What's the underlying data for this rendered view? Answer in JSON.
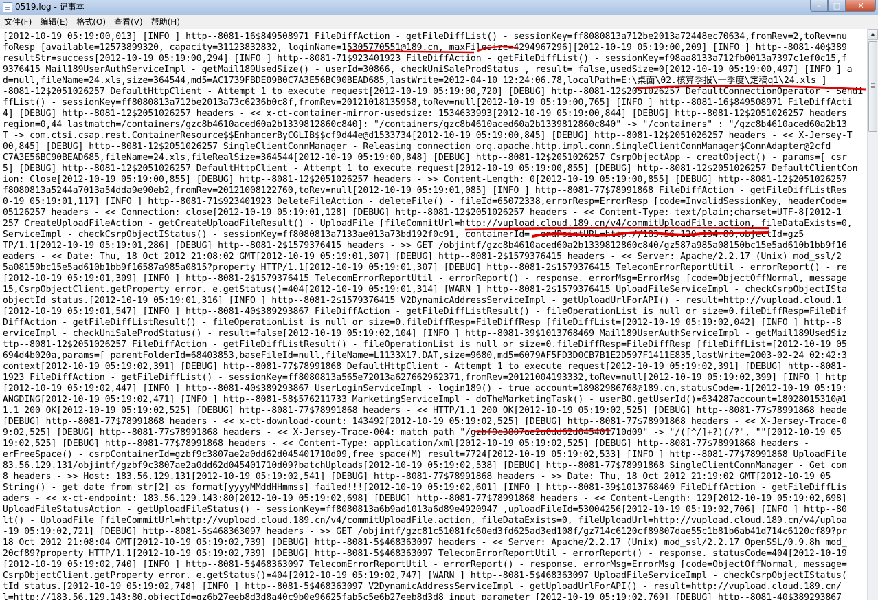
{
  "window": {
    "title": "0519.log - 记事本"
  },
  "menu": {
    "items": [
      "文件(F)",
      "编辑(E)",
      "格式(O)",
      "查看(V)",
      "帮助(H)"
    ]
  },
  "caption": {
    "min": "–",
    "max": "□",
    "close": "✕"
  },
  "scrollbar": {
    "up_arrow": "▲"
  },
  "document": {
    "lines": [
      "[2012-10-19 05:19:00,013] [INFO ] http--8081-16$849508971 FileDiffAction - getFileDiffList() - sessionKey=ff8080813a712be2013a72448ec70634,fromRev=2,toRev=nu",
      "foResp [available=12573899320, capacity=31123832832, loginName=15305770551@189.cn, maxFilesize=4294967296][2012-10-19 05:19:00,209] [INFO ] http--8081-40$389",
      "resultStr=success[2012-10-19 05:19:00,294] [INFO ] http--8081-71$923401923 FileDiffAction - getFileDiffList() - sessionKey=f98aa8133a712fb0013a7397c1ef0c15,f",
      "9376415 Mail189UserAuthServiceImpl - getMail189UsedSize() - userId=30866, checkUniSaleProdStatus , result= false,usedSize=0[2012-10-19 05:19:00,497] [INFO ] a",
      "d=null,fileName=24.xls,size=364544,md5=AC1739FBDE09B0C7A3E56BC90BEAD685,lastWrite=2012-04-10 12:24:06.78,localPath=E:\\桌面\\02.核算季报\\一季度\\定稿q1\\24.xls ]",
      "-8081-12$2051026257 DefaultHttpClient - Attempt 1 to execute request[2012-10-19 05:19:00,720] [DEBUG] http--8081-12$2051026257 DefaultConnectionOperator - Sendi",
      "ffList() - sessionKey=ff8080813a712be2013a73c6236b0c8f,fromRev=20121018135958,toRev=null[2012-10-19 05:19:00,765] [INFO ] http--8081-16$849508971 FileDiffActi",
      "4] [DEBUG] http--8081-12$2051026257 headers - << x-ct-container-mirror-usedsize: 1534633993[2012-10-19 05:19:00,844] [DEBUG] http--8081-12$2051026257 headers",
      "region=0,44 lastmatch=/containers/gzc8b4610aced60a2b1339812860c840]: \"/containers/gzc8b4610aced60a2b1339812860c840\" -> \"/containers\" : \"/gzc8b4610aced60a2b13",
      "T -> com.ctsi.csap.rest.ContainerResource$$EnhancerByCGLIB$$cf9d44e@d1533734[2012-10-19 05:19:00,845] [DEBUG] http--8081-12$2051026257 headers - << X-Jersey-T",
      "00,845] [DEBUG] http--8081-12$2051026257 SingleClientConnManager - Releasing connection org.apache.http.impl.conn.SingleClientConnManager$ConnAdapter@2cfd",
      "C7A3E56BC90BEAD685,fileName=24.xls,fileRealSize=364544[2012-10-19 05:19:00,848] [DEBUG] http--8081-12$2051026257 CsrpObjectApp - creatObject() - params=[ csr",
      "5] [DEBUG] http--8081-12$2051026257 DefaultHttpClient - Attempt 1 to execute request[2012-10-19 05:19:00,855] [DEBUG] http--8081-12$2051026257 DefaultClientCon",
      "ion: Close[2012-10-19 05:19:00,855] [DEBUG] http--8081-12$2051026257 headers - >> Content-Length: 0[2012-10-19 05:19:00,855] [DEBUG] http--8081-12$2051026257",
      "f8080813a5244a7013a54dda9e90eb2,fromRev=20121008122760,toRev=null[2012-10-19 05:19:01,085] [INFO ] http--8081-77$78991868 FileDiffAction - getFileDiffListRes",
      "0-19 05:19:01,117] [INFO ] http--8081-71$923401923 DeleteFileAction - deleteFile() - fileId=65072338,errorResp=ErrorResp [code=InvalidSessionKey, headerCode=",
      "05126257 headers - << Connection: close[2012-10-19 05:19:01,128] [DEBUG] http--8081-12$2051026257 headers - << Content-Type: text/plain;charset=UTF-8[2012-1",
      "257 CreateUploadFileAction - getCreateUploadFileResult() - UploadFile [fileCommitUrl=http://vupload.cloud.189.cn/v4/commitUploadFile.action, fileDataExists=0,",
      "ServiceImpl - checkCsrpObjectIStatus() - sessionKey=ff8080813a7133ae013a73bd192f0c91, containerId=, endPointURL=http://183.56.129.134:80,objectId=gz5",
      "TP/1.1[2012-10-19 05:19:01,286] [DEBUG] http--8081-2$1579376415 headers - >> GET /objintf/gzc8b4610aced60a2b1339812860c840/gz587a985a08150bc15e5ad610b1bb9f16",
      "eaders - << Date: Thu, 18 Oct 2012 21:08:02 GMT[2012-10-19 05:19:01,307] [DEBUG] http--8081-2$1579376415 headers - << Server: Apache/2.2.17 (Unix) mod_ssl/2",
      "5a08150bc15e5ad610b1bb9f16587a985a0815?property HTTP/1.1[2012-10-19 05:19:01,307] [DEBUG] http--8081-2$1579376415 TelecomErrorReportUtil - errorReport() - re",
      "[2012-10-19 05:19:01,309] [INFO ] http--8081-2$1579376415 TelecomErrorReportUtil - errorReport() - response. errorMsg=ErrorMsg [code=ObjectOffNormal, message",
      "15,CsrpObjectClient.getProperty error. e.getStatus()=404[2012-10-19 05:19:01,314] [WARN ] http--8081-2$1579376415 UploadFileServiceImpl - checkCsrpObjectISta",
      "objectId status.[2012-10-19 05:19:01,316] [INFO ] http--8081-2$1579376415 V2DynamicAddressServiceImpl - getUploadUrlForAPI() - result=http://vupload.cloud.1",
      "[2012-10-19 05:19:01,547] [INFO ] http--8081-40$389293867 FileDiffAction - getFileDiffListResult() - fileOperationList is null or size=0.fileDiffResp=FileDif",
      "DiffAction - getFileDiffListResult() - fileOperationList is null or size=0.fileDiffResp=FileDiffResp [fileDiffList=[2012-10-19 05:19:02,042] [INFO ] http--8",
      "erviceImpl - checkUniSaleProdStatus() - result=false[2012-10-19 05:19:02,104] [INFO ] http--8081-39$1013768469 Mail189UserAuthServiceImpl - getMail189UsedSiz",
      "ttp--8081-12$2051026257 FileDiffAction - getFileDiffListResult() - fileOperationList is null or size=0.fileDiffResp=FileDiffResp [fileDiffList=[2012-10-19 05",
      "694d4b020a,params=[ parentFolderId=68403853,baseFileId=null,fileName=L1133X17.DAT,size=9680,md5=6079AF5FD3D0CB7B1E2D597F1411E835,lastWrite=2003-02-24 02:42:3",
      "context[2012-10-19 05:19:02,391] [DEBUG] http--8081-77$78991868 DefaultHttpClient - Attempt 1 to execute request[2012-10-19 05:19:02,391] [DEBUG] http--8081-",
      "1923 FileDiffAction - getFileDiffList() - sessionKey=ff8080813a565e72013a627662962371,fromRev=20121004193332,toRev=null[2012-10-19 05:19:02,399] [INFO ] http",
      "[2012-10-19 05:19:02,447] [INFO ] http--8081-40$389293867 UserLoginServiceImpl - login189() - true account=18982986768@189.cn,statusCode=-1[2012-10-19 05:19:",
      "ANGDING[2012-10-19 05:19:02,471] [INFO ] http--8081-58$576211733 MarketingServiceImpl - doTheMarketingTask() - userBO.getUserId()=634287account=18028015310@1",
      "1.1 200 OK[2012-10-19 05:19:02,525] [DEBUG] http--8081-77$78991868 headers - << HTTP/1.1 200 OK[2012-10-19 05:19:02,525] [DEBUG] http--8081-77$78991868 heade",
      "[DEBUG] http--8081-77$78991868 headers - << x-ct-download-count: 143492[2012-10-19 05:19:02,525] [DEBUG] http--8081-77$78991868 headers - << X-Jersey-Trace-0",
      "9:02,525] [DEBUG] http--8081-77$78991868 headers - << X-Jersey-Trace-004: match path \"/gzbf9c3807ae2a0dd62d045401710d09\" -> \"/([^/]+?)(/?\", \"\"[2012-10-19 05",
      "19:02,525] [DEBUG] http--8081-77$78991868 headers - << Content-Type: application/xml[2012-10-19 05:19:02,525] [DEBUG] http--8081-77$78991868 headers -",
      "erFreeSpace() - csrpContainerId=gzbf9c3807ae2a0dd62d045401710d09,free space(M) result=7724[2012-10-19 05:19:02,533] [INFO ] http--8081-77$78991868 UploadFile",
      "83.56.129.131/objintf/gzbf9c3807ae2a0dd62d045401710d09?batchUploads[2012-10-19 05:19:02,538] [DEBUG] http--8081-77$78991868 SingleClientConnManager - Get con",
      "8 headers - >> Host: 183.56.129.131[2012-10-19 05:19:02,541] [DEBUG] http--8081-77$78991868 headers - >> Date: Thu, 18 Oct 2012 21:19:02 GMT[2012-10-19 05",
      "String() - get date from str[2] as format[yyyyMMddHHmmss] failed!!![2012-10-19 05:19:02,601] [INFO ] http--8081-39$1013768469 FileDiffAction - getFileDiffLis",
      "aders - << x-ct-endpoint: 183.56.129.143:80[2012-10-19 05:19:02,698] [DEBUG] http--8081-77$78991868 headers - << Content-Length: 129[2012-10-19 05:19:02,698]",
      "UploadFileStatusAction - getUploadFileStatus() - sessionKey=ff8080813a6b9ad1013a6d89e4920947 ,uploadFileId=53004256[2012-10-19 05:19:02,706] [INFO ] http--80",
      "lt() - UploadFile [fileCommitUrl=http://vupload.cloud.189.cn/v4/commitUploadFile.action, fileDataExists=0, fileUploadUrl=http://vupload.cloud.189.cn/v4/uploa",
      "-19 05:19:02,721] [DEBUG] http--8081-5$468363097 headers - >> GET /objintf/gzc81c51081fc60ed3fd625ad3ed108f/gz714c6120cf89807dae55c1b81b6ab41d714c6120cf89?pr",
      "18 Oct 2012 21:08:04 GMT[2012-10-19 05:19:02,739] [DEBUG] http--8081-5$468363097 headers - << Server: Apache/2.2.17 (Unix) mod_ssl/2.2.17 OpenSSL/0.9.8h mod_",
      "20cf89?property HTTP/1.1[2012-10-19 05:19:02,739] [DEBUG] http--8081-5$468363097 TelecomErrorReportUtil - errorReport() - response. statusCode=404[2012-10-19",
      "[2012-10-19 05:19:02,740] [INFO ] http--8081-5$468363097 TelecomErrorReportUtil - errorReport() - response. errorMsg=ErrorMsg [code=ObjectOffNormal, message=",
      "CsrpObjectClient.getProperty error. e.getStatus()=404[2012-10-19 05:19:02,747] [WARN ] http--8081-5$468363097 UploadFileServiceImpl - checkCsrpObjectIStatus(",
      "tId status.[2012-10-19 05:19:02,748] [INFO ] http--8081-5$468363097 V2DynamicAddressServiceImpl - getUploadUrlForAPI() - result=http://vupload.cloud.189.cn/",
      "l=http://183.56.129.143:80,objectId=gz6b27eeb8d3d8a40c9b0e96625fab5c5e6b27eeb8d3d8 input parameter [2012-10-19 05:19:02,769] [DEBUG] http--8081-40$389293867"
    ]
  }
}
